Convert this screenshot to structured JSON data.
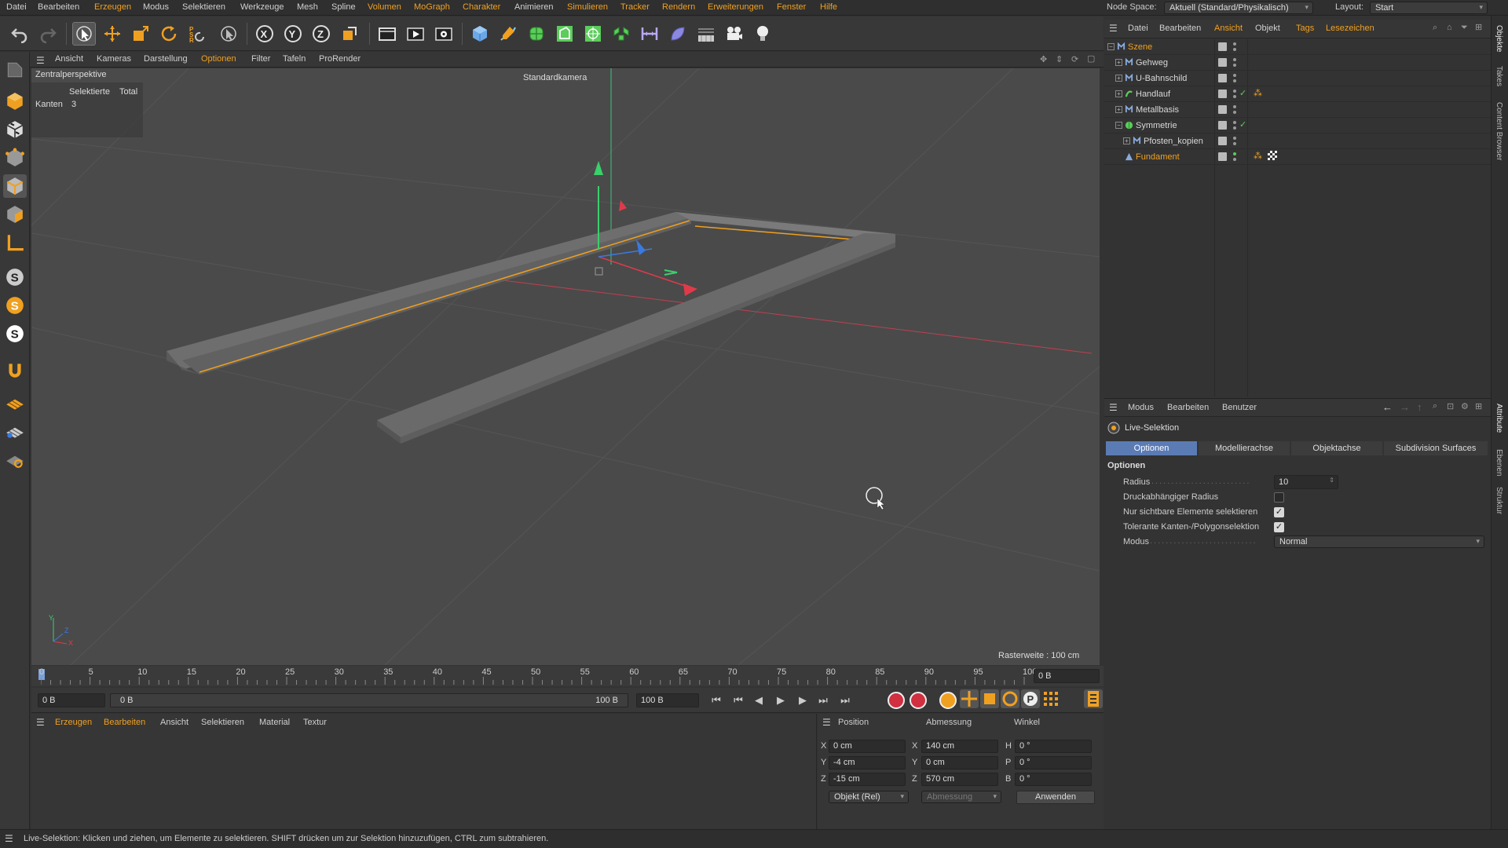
{
  "menubar": {
    "items": [
      "Datei",
      "Bearbeiten",
      "Erzeugen",
      "Modus",
      "Selektieren",
      "Werkzeuge",
      "Mesh",
      "Spline",
      "Volumen",
      "MoGraph",
      "Charakter",
      "Animieren",
      "Simulieren",
      "Tracker",
      "Rendern",
      "Erweiterungen",
      "Fenster",
      "Hilfe"
    ],
    "node_space_label": "Node Space:",
    "node_space_value": "Aktuell (Standard/Physikalisch)",
    "layout_label": "Layout:",
    "layout_value": "Start"
  },
  "toolbar": {
    "icons": [
      "undo-icon",
      "redo-icon",
      "live-selection-icon",
      "move-icon",
      "scale-icon",
      "rotate-icon",
      "psr-icon",
      "recent-tools-icon",
      "x-axis-lock-icon",
      "y-axis-lock-icon",
      "z-axis-lock-icon",
      "coordinate-system-icon",
      "render-region-icon",
      "render-view-icon",
      "render-settings-icon",
      "cube-icon",
      "pen-icon",
      "subdivision-icon",
      "extrude-icon",
      "cloner-icon",
      "deformer-icon",
      "spline-tool-icon",
      "effector-icon",
      "floor-icon",
      "camera-icon",
      "light-icon"
    ]
  },
  "viewport_menu": {
    "items": [
      "Ansicht",
      "Kameras",
      "Darstellung",
      "Optionen",
      "Filter",
      "Tafeln",
      "ProRender"
    ]
  },
  "viewport": {
    "view_name": "Zentralperspektive",
    "camera": "Standardkamera",
    "stats_header_selected": "Selektierte",
    "stats_header_total": "Total",
    "stats_row_label": "Kanten",
    "stats_row_value": "3",
    "grid_label": "Rasterweite : 100 cm",
    "axis_y": "Y",
    "axis_z": "Z",
    "axis_x": "X"
  },
  "timeline": {
    "ticks": [
      "0",
      "5",
      "10",
      "15",
      "20",
      "25",
      "30",
      "35",
      "40",
      "45",
      "50",
      "55",
      "60",
      "65",
      "70",
      "75",
      "80",
      "85",
      "90",
      "95",
      "100"
    ],
    "current_frame": "0 B",
    "start_field": "0 B",
    "range_start": "0 B",
    "range_end": "100 B",
    "end_field": "100 B"
  },
  "material_manager": {
    "items": [
      "Erzeugen",
      "Bearbeiten",
      "Ansicht",
      "Selektieren",
      "Material",
      "Textur"
    ]
  },
  "coordinates": {
    "header_position": "Position",
    "header_size": "Abmessung",
    "header_rotation": "Winkel",
    "pos": {
      "x": "0 cm",
      "y": "-4 cm",
      "z": "-15 cm"
    },
    "size": {
      "x": "140 cm",
      "y": "0 cm",
      "z": "570 cm"
    },
    "rot": {
      "h": "0 °",
      "p": "0 °",
      "b": "0 °"
    },
    "axis_labels": {
      "x": "X",
      "y": "Y",
      "z": "Z",
      "h": "H",
      "p": "P",
      "b": "B"
    },
    "mode": "Objekt (Rel)",
    "size_mode": "Abmessung",
    "apply": "Anwenden"
  },
  "status_bar": {
    "text": "Live-Selektion: Klicken und ziehen, um Elemente zu selektieren. SHIFT drücken um zur Selektion hinzuzufügen, CTRL zum subtrahieren."
  },
  "object_manager": {
    "menu": [
      "Datei",
      "Bearbeiten",
      "Ansicht",
      "Objekt",
      "Tags",
      "Lesezeichen"
    ],
    "objects": [
      {
        "name": "Szene",
        "highlight": true
      },
      {
        "name": "Gehweg",
        "highlight": false
      },
      {
        "name": "U-Bahnschild",
        "highlight": false
      },
      {
        "name": "Handlauf",
        "highlight": false
      },
      {
        "name": "Metallbasis",
        "highlight": false
      },
      {
        "name": "Symmetrie",
        "highlight": false
      },
      {
        "name": "Pfosten_kopien",
        "highlight": false
      },
      {
        "name": "Fundament",
        "highlight": true
      }
    ]
  },
  "attribute_manager": {
    "menu": [
      "Modus",
      "Bearbeiten",
      "Benutzer"
    ],
    "tool_name": "Live-Selektion",
    "tabs": [
      "Optionen",
      "Modellierachse",
      "Objektachse",
      "Subdivision Surfaces"
    ],
    "section": "Optionen",
    "fields": {
      "radius_label": "Radius",
      "radius_value": "10",
      "pressure_label": "Druckabhängiger Radius",
      "visible_only_label": "Nur sichtbare Elemente selektieren",
      "tolerant_label": "Tolerante Kanten-/Polygonselektion",
      "mode_label": "Modus",
      "mode_value": "Normal"
    }
  },
  "side_tabs": [
    "Objekte",
    "Takes",
    "Content Browser",
    "Attribute",
    "Ebenen",
    "Struktur"
  ],
  "colors": {
    "accent": "#f0a020",
    "tab_active": "#5b7bb5",
    "axis_x": "#e03a4a",
    "axis_y": "#3ad06a",
    "axis_z": "#3a7ae0"
  }
}
